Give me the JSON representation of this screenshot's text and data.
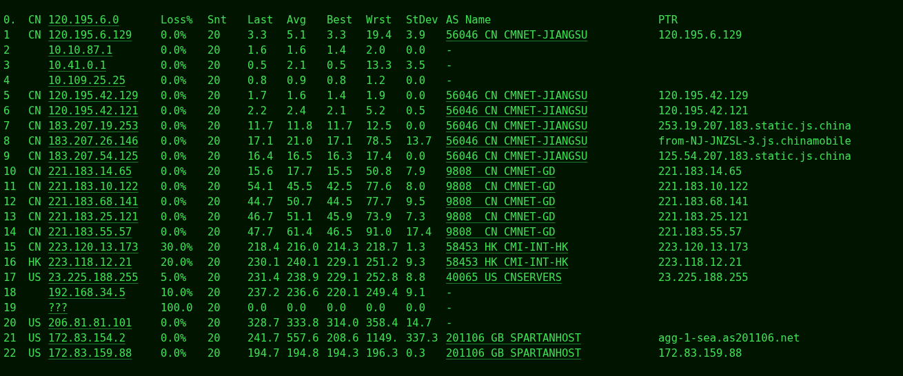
{
  "header": {
    "hop": "0.",
    "country": "CN",
    "host": "120.195.6.0",
    "columns": [
      "Loss%",
      "Snt",
      "Last",
      "Avg",
      "Best",
      "Wrst",
      "StDev",
      "AS Name",
      "PTR"
    ]
  },
  "rows": [
    {
      "hop": "1",
      "country": "CN",
      "host": "120.195.6.129",
      "loss": "0.0%",
      "snt": "20",
      "last": "3.3",
      "avg": "5.1",
      "best": "3.3",
      "wrst": "19.4",
      "stdev": "3.9",
      "as_name": "56046 CN CMNET-JIANGSU",
      "as_link": true,
      "ptr": "120.195.6.129"
    },
    {
      "hop": "2",
      "host": "10.10.87.1",
      "loss": "0.0%",
      "snt": "20",
      "last": "1.6",
      "avg": "1.6",
      "best": "1.4",
      "wrst": "2.0",
      "stdev": "0.0",
      "as_name": "-",
      "as_link": false
    },
    {
      "hop": "3",
      "host": "10.41.0.1",
      "loss": "0.0%",
      "snt": "20",
      "last": "0.5",
      "avg": "2.1",
      "best": "0.5",
      "wrst": "13.3",
      "stdev": "3.5",
      "as_name": "-",
      "as_link": false
    },
    {
      "hop": "4",
      "host": "10.109.25.25",
      "loss": "0.0%",
      "snt": "20",
      "last": "0.8",
      "avg": "0.9",
      "best": "0.8",
      "wrst": "1.2",
      "stdev": "0.0",
      "as_name": "-",
      "as_link": false
    },
    {
      "hop": "5",
      "country": "CN",
      "host": "120.195.42.129",
      "loss": "0.0%",
      "snt": "20",
      "last": "1.7",
      "avg": "1.6",
      "best": "1.4",
      "wrst": "1.9",
      "stdev": "0.0",
      "as_name": "56046 CN CMNET-JIANGSU",
      "as_link": true,
      "ptr": "120.195.42.129"
    },
    {
      "hop": "6",
      "country": "CN",
      "host": "120.195.42.121",
      "loss": "0.0%",
      "snt": "20",
      "last": "2.2",
      "avg": "2.4",
      "best": "2.1",
      "wrst": "5.2",
      "stdev": "0.5",
      "as_name": "56046 CN CMNET-JIANGSU",
      "as_link": true,
      "ptr": "120.195.42.121"
    },
    {
      "hop": "7",
      "country": "CN",
      "host": "183.207.19.253",
      "loss": "0.0%",
      "snt": "20",
      "last": "11.7",
      "avg": "11.8",
      "best": "11.7",
      "wrst": "12.5",
      "stdev": "0.0",
      "as_name": "56046 CN CMNET-JIANGSU",
      "as_link": true,
      "ptr": "253.19.207.183.static.js.china"
    },
    {
      "hop": "8",
      "country": "CN",
      "host": "183.207.26.146",
      "loss": "0.0%",
      "snt": "20",
      "last": "17.1",
      "avg": "21.0",
      "best": "17.1",
      "wrst": "78.5",
      "stdev": "13.7",
      "as_name": "56046 CN CMNET-JIANGSU",
      "as_link": true,
      "ptr": "from-NJ-JNZSL-3.js.chinamobile"
    },
    {
      "hop": "9",
      "country": "CN",
      "host": "183.207.54.125",
      "loss": "0.0%",
      "snt": "20",
      "last": "16.4",
      "avg": "16.5",
      "best": "16.3",
      "wrst": "17.4",
      "stdev": "0.0",
      "as_name": "56046 CN CMNET-JIANGSU",
      "as_link": true,
      "ptr": "125.54.207.183.static.js.china"
    },
    {
      "hop": "10",
      "country": "CN",
      "host": "221.183.14.65",
      "loss": "0.0%",
      "snt": "20",
      "last": "15.6",
      "avg": "17.7",
      "best": "15.5",
      "wrst": "50.8",
      "stdev": "7.9",
      "as_name": "9808  CN CMNET-GD",
      "as_link": true,
      "ptr": "221.183.14.65"
    },
    {
      "hop": "11",
      "country": "CN",
      "host": "221.183.10.122",
      "loss": "0.0%",
      "snt": "20",
      "last": "54.1",
      "avg": "45.5",
      "best": "42.5",
      "wrst": "77.6",
      "stdev": "8.0",
      "as_name": "9808  CN CMNET-GD",
      "as_link": true,
      "ptr": "221.183.10.122"
    },
    {
      "hop": "12",
      "country": "CN",
      "host": "221.183.68.141",
      "loss": "0.0%",
      "snt": "20",
      "last": "44.7",
      "avg": "50.7",
      "best": "44.5",
      "wrst": "77.7",
      "stdev": "9.5",
      "as_name": "9808  CN CMNET-GD",
      "as_link": true,
      "ptr": "221.183.68.141"
    },
    {
      "hop": "13",
      "country": "CN",
      "host": "221.183.25.121",
      "loss": "0.0%",
      "snt": "20",
      "last": "46.7",
      "avg": "51.1",
      "best": "45.9",
      "wrst": "73.9",
      "stdev": "7.3",
      "as_name": "9808  CN CMNET-GD",
      "as_link": true,
      "ptr": "221.183.25.121"
    },
    {
      "hop": "14",
      "country": "CN",
      "host": "221.183.55.57",
      "loss": "0.0%",
      "snt": "20",
      "last": "47.7",
      "avg": "61.4",
      "best": "46.5",
      "wrst": "91.0",
      "stdev": "17.4",
      "as_name": "9808  CN CMNET-GD",
      "as_link": true,
      "ptr": "221.183.55.57"
    },
    {
      "hop": "15",
      "country": "CN",
      "host": "223.120.13.173",
      "loss": "30.0%",
      "snt": "20",
      "last": "218.4",
      "avg": "216.0",
      "best": "214.3",
      "wrst": "218.7",
      "stdev": "1.3",
      "as_name": "58453 HK CMI-INT-HK",
      "as_link": true,
      "ptr": "223.120.13.173"
    },
    {
      "hop": "16",
      "country": "HK",
      "host": "223.118.12.21",
      "loss": "20.0%",
      "snt": "20",
      "last": "230.1",
      "avg": "240.1",
      "best": "229.1",
      "wrst": "251.2",
      "stdev": "9.3",
      "as_name": "58453 HK CMI-INT-HK",
      "as_link": true,
      "ptr": "223.118.12.21"
    },
    {
      "hop": "17",
      "country": "US",
      "host": "23.225.188.255",
      "loss": "5.0%",
      "snt": "20",
      "last": "231.4",
      "avg": "238.9",
      "best": "229.1",
      "wrst": "252.8",
      "stdev": "8.8",
      "as_name": "40065 US CNSERVERS",
      "as_link": true,
      "ptr": "23.225.188.255"
    },
    {
      "hop": "18",
      "host": "192.168.34.5",
      "loss": "10.0%",
      "snt": "20",
      "last": "237.2",
      "avg": "236.6",
      "best": "220.1",
      "wrst": "249.4",
      "stdev": "9.1",
      "as_name": "-",
      "as_link": false
    },
    {
      "hop": "19",
      "host": "???",
      "loss": "100.0",
      "snt": "20",
      "last": "0.0",
      "avg": "0.0",
      "best": "0.0",
      "wrst": "0.0",
      "stdev": "0.0",
      "as_name": "-",
      "as_link": false
    },
    {
      "hop": "20",
      "country": "US",
      "host": "206.81.81.101",
      "loss": "0.0%",
      "snt": "20",
      "last": "328.7",
      "avg": "333.8",
      "best": "314.0",
      "wrst": "358.4",
      "stdev": "14.7",
      "as_name": "-",
      "as_link": false
    },
    {
      "hop": "21",
      "country": "US",
      "host": "172.83.154.2",
      "loss": "0.0%",
      "snt": "20",
      "last": "241.7",
      "avg": "557.6",
      "best": "208.6",
      "wrst": "1149.",
      "stdev": "337.3",
      "as_name": "201106 GB SPARTANHOST",
      "as_link": true,
      "ptr": "agg-1-sea.as201106.net"
    },
    {
      "hop": "22",
      "country": "US",
      "host": "172.83.159.88",
      "loss": "0.0%",
      "snt": "20",
      "last": "194.7",
      "avg": "194.8",
      "best": "194.3",
      "wrst": "196.3",
      "stdev": "0.3",
      "as_name": "201106 GB SPARTANHOST",
      "as_link": true,
      "ptr": "172.83.159.88"
    }
  ]
}
